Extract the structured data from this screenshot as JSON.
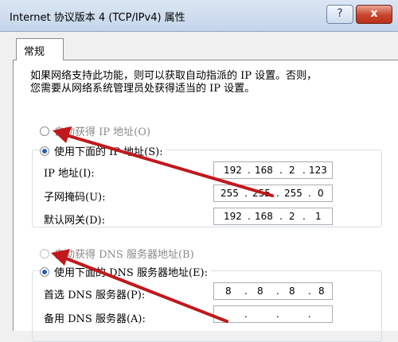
{
  "window": {
    "title": "Internet 协议版本 4 (TCP/IPv4) 属性",
    "help_label": "?",
    "close_label": "x"
  },
  "tabs": [
    {
      "label": "常规"
    }
  ],
  "description": {
    "line1": "如果网络支持此功能，则可以获取自动指派的 IP 设置。否则，",
    "line2": "您需要从网络系统管理员处获得适当的 IP 设置。"
  },
  "ip_section": {
    "auto_label": "自动获得 IP 地址(O)",
    "manual_label": "使用下面的 IP 地址(S):",
    "selected": "manual",
    "fields": [
      {
        "label": "IP 地址(I):",
        "octets": [
          "192",
          "168",
          "2",
          "123"
        ]
      },
      {
        "label": "子网掩码(U):",
        "octets": [
          "255",
          "255",
          "255",
          "0"
        ]
      },
      {
        "label": "默认网关(D):",
        "octets": [
          "192",
          "168",
          "2",
          "1"
        ]
      }
    ]
  },
  "dns_section": {
    "auto_label": "自动获得 DNS 服务器地址(B)",
    "manual_label": "使用下面的 DNS 服务器地址(E):",
    "selected": "manual",
    "fields": [
      {
        "label": "首选 DNS 服务器(P):",
        "octets": [
          "8",
          "8",
          "8",
          "8"
        ]
      },
      {
        "label": "备用 DNS 服务器(A):",
        "octets": [
          "",
          "",
          "",
          ""
        ]
      }
    ]
  },
  "annotation_color": "#c0181c"
}
